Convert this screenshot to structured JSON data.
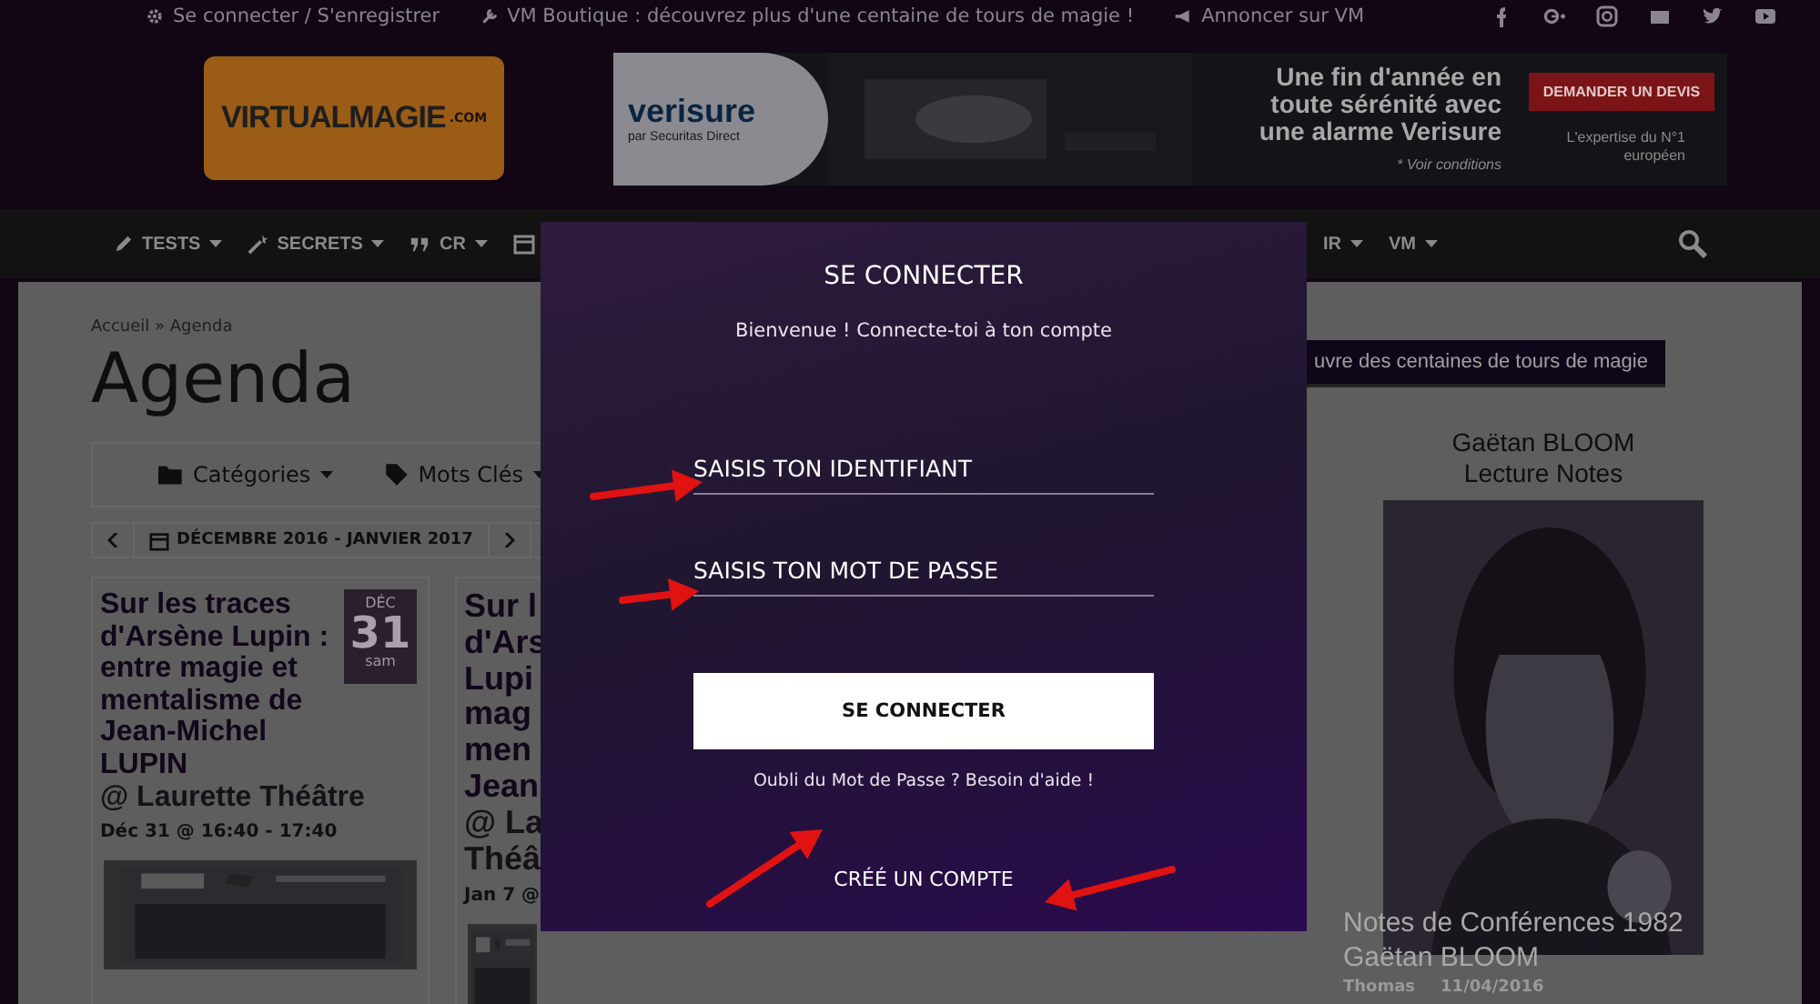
{
  "top_bar": {
    "links": [
      {
        "text": "Se connecter / S'enregistrer"
      },
      {
        "text": "VM Boutique : découvrez plus d'une centaine de tours de magie !"
      },
      {
        "text": "Annoncer sur VM"
      }
    ]
  },
  "logo": {
    "text": "VIRTUALMAGIE",
    "suffix": ".COM"
  },
  "ad": {
    "brand": "verisure",
    "brand_sub": "par Securitas Direct",
    "headline": "Une fin d'année en toute sérénité avec une alarme Verisure",
    "cta": "DEMANDER UN DEVIS",
    "note": "* Voir conditions",
    "tagline": "L'expertise du N°1 européen"
  },
  "nav": {
    "left": [
      {
        "label": "TESTS"
      },
      {
        "label": "SECRETS"
      },
      {
        "label": "CR"
      }
    ],
    "right": [
      {
        "label": "IR"
      },
      {
        "label": "VM"
      }
    ]
  },
  "breadcrumb": "Accueil » Agenda",
  "page_title": "Agenda",
  "filters": [
    {
      "label": "Catégories"
    },
    {
      "label": "Mots Clés"
    }
  ],
  "month_nav": {
    "label": "DÉCEMBRE 2016 - JANVIER 2017"
  },
  "events": [
    {
      "title": "Sur les traces d'Arsène Lupin : entre magie et mentalisme de Jean-Michel LUPIN",
      "location": "@ Laurette Théâtre",
      "meta": "Déc 31 @ 16:40 - 17:40",
      "badge": {
        "month": "DÉC",
        "day": "31",
        "weekday": "sam"
      }
    },
    {
      "title": "Sur l\nd'Ars\nLupi\nmag\nmen\nJean",
      "location": "@ La\nThéâ",
      "meta": "Jan 7 @"
    }
  ],
  "sidebar": {
    "heading": "uvre des centaines de tours de magie",
    "book_title": "Gaëtan BLOOM\nLecture Notes",
    "caption": "Notes de Conférences 1982\nGaëtan BLOOM",
    "author": "Thomas",
    "date": "11/04/2016"
  },
  "modal": {
    "title": "SE CONNECTER",
    "subtitle": "Bienvenue ! Connecte-toi à ton compte",
    "fields": [
      {
        "placeholder": "SAISIS TON IDENTIFIANT"
      },
      {
        "placeholder": "SAISIS TON MOT DE PASSE"
      }
    ],
    "submit": "SE CONNECTER",
    "forgot": "Oubli du Mot de Passe ? Besoin d'aide !",
    "create": "CRÉÉ UN COMPTE"
  }
}
